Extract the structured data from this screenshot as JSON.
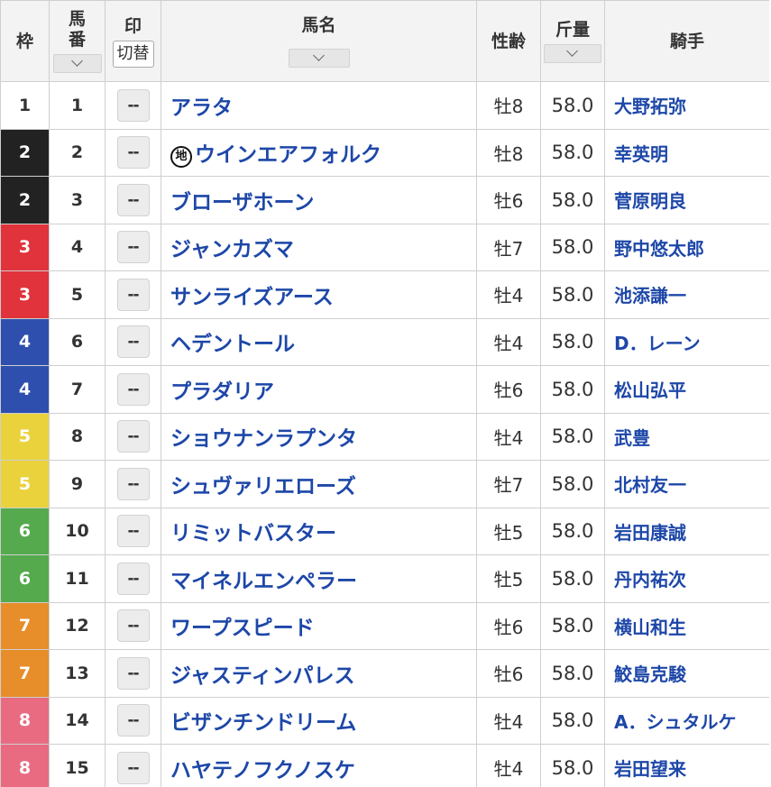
{
  "header": {
    "waku": "枠",
    "umaban": "馬番",
    "mark": "印",
    "toggle": "切替",
    "horse": "馬名",
    "sexage": "性齢",
    "weight": "斤量",
    "jockey": "騎手"
  },
  "colors": {
    "horse_text": "#1d47a8",
    "waku": {
      "1": {
        "bg": "#ffffff",
        "fg": "#333333"
      },
      "2": {
        "bg": "#222222",
        "fg": "#ffffff"
      },
      "3": {
        "bg": "#e0333b",
        "fg": "#ffffff"
      },
      "4": {
        "bg": "#2e4fae",
        "fg": "#ffffff"
      },
      "5": {
        "bg": "#e9d23c",
        "fg": "#ffffff"
      },
      "6": {
        "bg": "#55aa4e",
        "fg": "#ffffff"
      },
      "7": {
        "bg": "#e78d2a",
        "fg": "#ffffff"
      },
      "8": {
        "bg": "#e86b82",
        "fg": "#ffffff"
      }
    }
  },
  "rows": [
    {
      "waku": "1",
      "umaban": "1",
      "mark": "--",
      "chiho": "",
      "horse": "アラタ",
      "sexage": "牡8",
      "weight": "58.0",
      "jockey": "大野拓弥"
    },
    {
      "waku": "2",
      "umaban": "2",
      "mark": "--",
      "chiho": "地",
      "horse": "ウインエアフォルク",
      "sexage": "牡8",
      "weight": "58.0",
      "jockey": "幸英明"
    },
    {
      "waku": "2",
      "umaban": "3",
      "mark": "--",
      "chiho": "",
      "horse": "ブローザホーン",
      "sexage": "牡6",
      "weight": "58.0",
      "jockey": "菅原明良"
    },
    {
      "waku": "3",
      "umaban": "4",
      "mark": "--",
      "chiho": "",
      "horse": "ジャンカズマ",
      "sexage": "牡7",
      "weight": "58.0",
      "jockey": "野中悠太郎"
    },
    {
      "waku": "3",
      "umaban": "5",
      "mark": "--",
      "chiho": "",
      "horse": "サンライズアース",
      "sexage": "牡4",
      "weight": "58.0",
      "jockey": "池添謙一"
    },
    {
      "waku": "4",
      "umaban": "6",
      "mark": "--",
      "chiho": "",
      "horse": "ヘデントール",
      "sexage": "牡4",
      "weight": "58.0",
      "jockey": "D．レーン"
    },
    {
      "waku": "4",
      "umaban": "7",
      "mark": "--",
      "chiho": "",
      "horse": "プラダリア",
      "sexage": "牡6",
      "weight": "58.0",
      "jockey": "松山弘平"
    },
    {
      "waku": "5",
      "umaban": "8",
      "mark": "--",
      "chiho": "",
      "horse": "ショウナンラプンタ",
      "sexage": "牡4",
      "weight": "58.0",
      "jockey": "武豊"
    },
    {
      "waku": "5",
      "umaban": "9",
      "mark": "--",
      "chiho": "",
      "horse": "シュヴァリエローズ",
      "sexage": "牡7",
      "weight": "58.0",
      "jockey": "北村友一"
    },
    {
      "waku": "6",
      "umaban": "10",
      "mark": "--",
      "chiho": "",
      "horse": "リミットバスター",
      "sexage": "牡5",
      "weight": "58.0",
      "jockey": "岩田康誠"
    },
    {
      "waku": "6",
      "umaban": "11",
      "mark": "--",
      "chiho": "",
      "horse": "マイネルエンペラー",
      "sexage": "牡5",
      "weight": "58.0",
      "jockey": "丹内祐次"
    },
    {
      "waku": "7",
      "umaban": "12",
      "mark": "--",
      "chiho": "",
      "horse": "ワープスピード",
      "sexage": "牡6",
      "weight": "58.0",
      "jockey": "横山和生"
    },
    {
      "waku": "7",
      "umaban": "13",
      "mark": "--",
      "chiho": "",
      "horse": "ジャスティンパレス",
      "sexage": "牡6",
      "weight": "58.0",
      "jockey": "鮫島克駿"
    },
    {
      "waku": "8",
      "umaban": "14",
      "mark": "--",
      "chiho": "",
      "horse": "ビザンチンドリーム",
      "sexage": "牡4",
      "weight": "58.0",
      "jockey": "A．シュタルケ"
    },
    {
      "waku": "8",
      "umaban": "15",
      "mark": "--",
      "chiho": "",
      "horse": "ハヤテノフクノスケ",
      "sexage": "牡4",
      "weight": "58.0",
      "jockey": "岩田望来"
    }
  ]
}
